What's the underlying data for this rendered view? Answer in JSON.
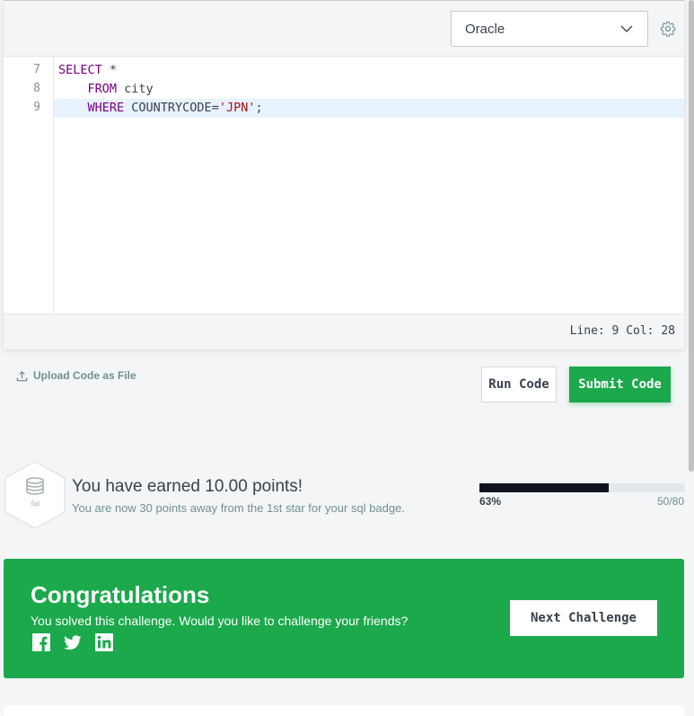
{
  "editor": {
    "language": "Oracle",
    "lines": [
      {
        "num": "7",
        "parts": [
          {
            "t": "SELECT",
            "c": "kw"
          },
          {
            "t": " *",
            "c": ""
          }
        ]
      },
      {
        "num": "8",
        "parts": [
          {
            "t": "    ",
            "c": ""
          },
          {
            "t": "FROM",
            "c": "kw"
          },
          {
            "t": " city",
            "c": ""
          }
        ]
      },
      {
        "num": "9",
        "parts": [
          {
            "t": "    ",
            "c": ""
          },
          {
            "t": "WHERE",
            "c": "kw"
          },
          {
            "t": " COUNTRYCODE=",
            "c": ""
          },
          {
            "t": "'JPN'",
            "c": "str"
          },
          {
            "t": ";",
            "c": ""
          }
        ]
      }
    ],
    "active_line": 2,
    "cursor": "Line: 9 Col: 28"
  },
  "actions": {
    "upload_label": "Upload Code as File",
    "run_label": "Run Code",
    "submit_label": "Submit Code"
  },
  "points": {
    "badge_label": "Sql",
    "title": "You have earned 10.00 points!",
    "subtitle": "You are now 30 points away from the 1st star for your sql badge.",
    "progress_fraction": 0.63,
    "percent_label": "63%",
    "ratio_label": "50/80"
  },
  "congrats": {
    "title": "Congratulations",
    "message": "You solved this challenge. Would you like to challenge your friends?",
    "next_label": "Next Challenge",
    "social_icons": [
      "facebook-icon",
      "twitter-icon",
      "linkedin-icon"
    ]
  },
  "colors": {
    "accent_green": "#1ba94c",
    "progress_dark": "#0e141e"
  }
}
